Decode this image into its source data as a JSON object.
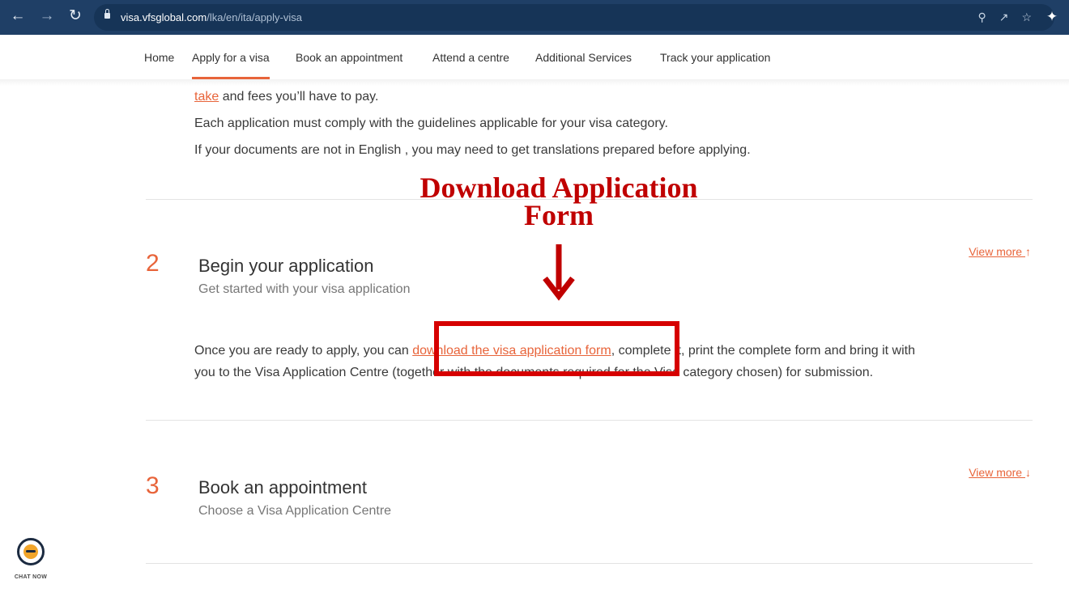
{
  "browser": {
    "url_host": "visa.vfsglobal.com",
    "url_path": "/lka/en/ita/apply-visa"
  },
  "nav": {
    "items": [
      {
        "label": "Home"
      },
      {
        "label": "Apply for a visa",
        "active": true
      },
      {
        "label": "Book an appointment"
      },
      {
        "label": "Attend a centre"
      },
      {
        "label": "Additional Services"
      },
      {
        "label": "Track your application"
      }
    ]
  },
  "step1": {
    "line1_link": "take",
    "line1_rest": " and fees you’ll have to pay.",
    "line2": "Each application must comply with the guidelines applicable for your visa category.",
    "line3": "If your documents are not in English , you may need to get translations prepared before applying."
  },
  "step2": {
    "number": "2",
    "title": "Begin your application",
    "subtitle": "Get started with your visa application",
    "view_more": "View more ",
    "view_more_arrow": "↑",
    "body_before": "Once you are ready to apply, you can ",
    "body_link": "download the visa application form",
    "body_after": ", complete it, print the complete form and bring it with",
    "body_line2": "you to the Visa Application Centre (together with the documents required for the Visa category chosen) for submission."
  },
  "step3": {
    "number": "3",
    "title": "Book an appointment",
    "subtitle": "Choose a Visa Application Centre",
    "view_more": "View more ",
    "view_more_arrow": "↓"
  },
  "annotation": {
    "title_line1": "Download Application",
    "title_line2": "Form",
    "color": "#c00000"
  },
  "chat": {
    "label": "CHAT NOW"
  },
  "colors": {
    "accent": "#e8643a",
    "chrome": "#1f3f66"
  }
}
